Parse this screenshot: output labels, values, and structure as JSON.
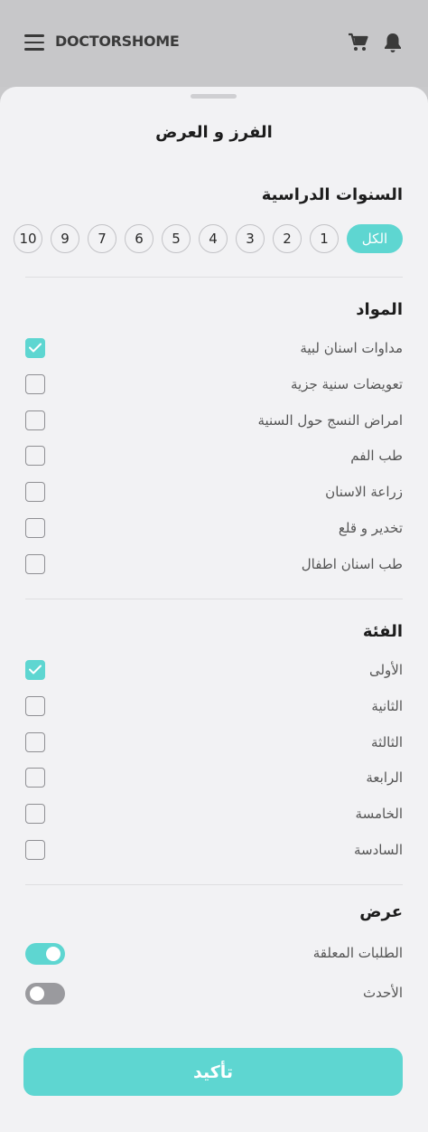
{
  "header": {
    "logo": "DOCTORSHOME",
    "icons": [
      "menu-icon",
      "cart-icon",
      "bell-icon"
    ]
  },
  "sheet": {
    "title": "الفرز و العرض"
  },
  "years": {
    "title": "السنوات الدراسية",
    "chips": [
      "الكل",
      "1",
      "2",
      "3",
      "4",
      "5",
      "6",
      "7",
      "9",
      "10"
    ],
    "selected": "الكل"
  },
  "subjects": {
    "title": "المواد",
    "items": [
      {
        "label": "مداوات اسنان لبية",
        "checked": true
      },
      {
        "label": "تعويضات سنية جزية",
        "checked": false
      },
      {
        "label": "امراض النسج حول السنية",
        "checked": false
      },
      {
        "label": "طب الفم",
        "checked": false
      },
      {
        "label": "زراعة الاسنان",
        "checked": false
      },
      {
        "label": "تخدير و قلع",
        "checked": false
      },
      {
        "label": "طب اسنان اطفال",
        "checked": false
      }
    ]
  },
  "category": {
    "title": "الفئة",
    "items": [
      {
        "label": "الأولى",
        "checked": true
      },
      {
        "label": "الثانية",
        "checked": false
      },
      {
        "label": "الثالثة",
        "checked": false
      },
      {
        "label": "الرابعة",
        "checked": false
      },
      {
        "label": "الخامسة",
        "checked": false
      },
      {
        "label": "السادسة",
        "checked": false
      }
    ]
  },
  "display": {
    "title": "عرض",
    "toggles": [
      {
        "label": "الطلبات المعلقة",
        "on": true
      },
      {
        "label": "الأحدث",
        "on": false
      }
    ]
  },
  "confirm_label": "تأكيد",
  "colors": {
    "accent": "#5ed6d1",
    "sheet_bg": "#f2f2f4",
    "appbar_bg": "#c7c7c9"
  }
}
